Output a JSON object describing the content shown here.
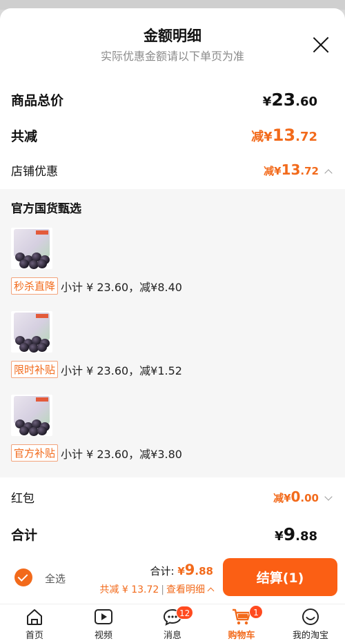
{
  "header": {
    "title": "金额明细",
    "subtitle": "实际优惠金额请以下单页为准"
  },
  "summary": {
    "goods_total_label": "商品总价",
    "goods_total_symbol": "¥",
    "goods_total_int": "23",
    "goods_total_dec": ".60",
    "total_discount_label": "共减",
    "total_discount_prefix": "减¥",
    "total_discount_int": "13",
    "total_discount_dec": ".72",
    "store_discount_label": "店铺优惠",
    "store_discount_prefix": "减¥",
    "store_discount_int": "13",
    "store_discount_dec": ".72"
  },
  "store": {
    "name": "官方国货甄选",
    "items": [
      {
        "badge": "秒杀直降",
        "text": "小计 ¥ 23.60，减¥8.40"
      },
      {
        "badge": "限时补贴",
        "text": "小计 ¥ 23.60，减¥1.52"
      },
      {
        "badge": "官方补贴",
        "text": "小计 ¥ 23.60，减¥3.80"
      }
    ]
  },
  "footer_rows": {
    "red_packet_label": "红包",
    "red_packet_prefix": "减¥",
    "red_packet_int": "0",
    "red_packet_dec": ".00",
    "total_label": "合计",
    "total_symbol": "¥",
    "total_int": "9",
    "total_dec": ".88"
  },
  "bottom_bar": {
    "select_all": "全选",
    "total_prefix": "合计: ",
    "total_symbol": "¥",
    "total_int": "9",
    "total_dec": ".88",
    "discount_text": "共减 ¥ 13.72",
    "sep": "|",
    "detail_link": "查看明细",
    "checkout_label": "结算(1)"
  },
  "tabbar": {
    "tabs": [
      {
        "label": "首页",
        "icon": "home-icon"
      },
      {
        "label": "视频",
        "icon": "video-icon"
      },
      {
        "label": "消息",
        "icon": "message-icon",
        "badge": "12"
      },
      {
        "label": "购物车",
        "icon": "cart-icon",
        "badge": "1"
      },
      {
        "label": "我的淘宝",
        "icon": "profile-icon"
      }
    ]
  },
  "colors": {
    "accent": "#f26a1b",
    "checkout": "#fb5f14",
    "badge": "#ff4a1f"
  }
}
